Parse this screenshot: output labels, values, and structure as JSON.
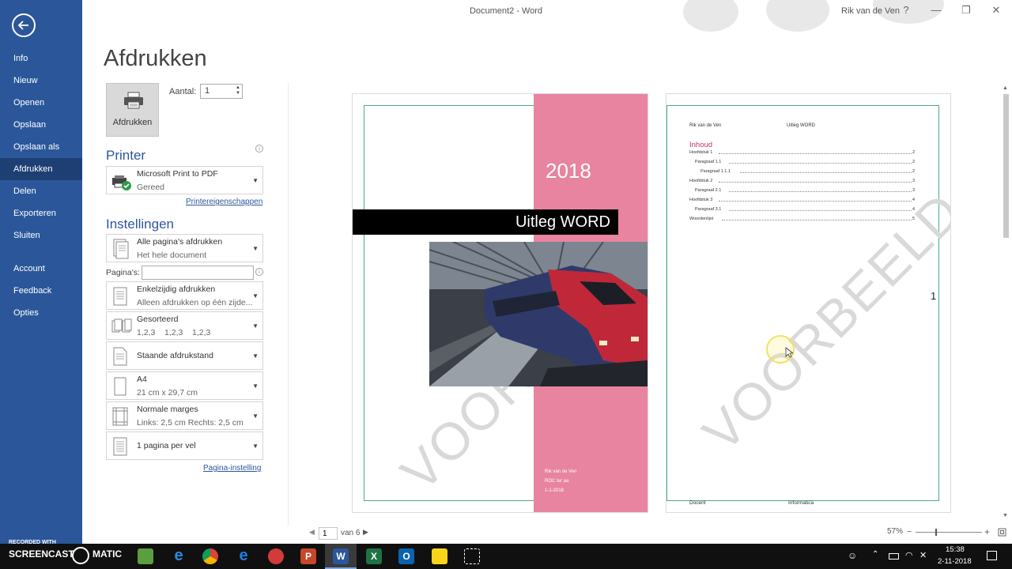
{
  "window": {
    "title": "Document2  -  Word",
    "user": "Rik van de Ven",
    "help": "?",
    "minimize": "—",
    "restore": "❐",
    "close": "✕"
  },
  "nav": {
    "items": [
      {
        "label": "Info"
      },
      {
        "label": "Nieuw"
      },
      {
        "label": "Openen"
      },
      {
        "label": "Opslaan"
      },
      {
        "label": "Opslaan als"
      },
      {
        "label": "Afdrukken"
      },
      {
        "label": "Delen"
      },
      {
        "label": "Exporteren"
      },
      {
        "label": "Sluiten"
      },
      {
        "label": "Account"
      },
      {
        "label": "Feedback"
      },
      {
        "label": "Opties"
      }
    ],
    "active": "Afdrukken"
  },
  "print": {
    "heading": "Afdrukken",
    "button_label": "Afdrukken",
    "copies_label": "Aantal:",
    "copies_value": "1",
    "printer_section": "Printer",
    "printer_name": "Microsoft Print to PDF",
    "printer_status": "Gereed",
    "printer_properties_link": "Printereigenschappen",
    "settings_section": "Instellingen",
    "pages_label": "Pagina's:",
    "pages_value": "",
    "setting_pages": {
      "main": "Alle pagina's afdrukken",
      "sub": "Het hele document"
    },
    "setting_sides": {
      "main": "Enkelzijdig afdrukken",
      "sub": "Alleen afdrukken op één zijde..."
    },
    "setting_collate": {
      "main": "Gesorteerd",
      "sub": "1,2,3    1,2,3    1,2,3"
    },
    "setting_orientation": {
      "main": "Staande afdrukstand"
    },
    "setting_paper": {
      "main": "A4",
      "sub": "21 cm x 29,7 cm"
    },
    "setting_margins": {
      "main": "Normale marges",
      "sub": "Links: 2,5 cm  Rechts: 2,5 cm"
    },
    "setting_persheet": {
      "main": "1 pagina per vel"
    },
    "page_setup_link": "Pagina-instelling"
  },
  "preview": {
    "cover": {
      "year": "2018",
      "title": "Uitleg WORD",
      "watermark": "VOORBEELD",
      "meta": [
        "Rik van de Ven",
        "ROC ter aa",
        "1-1-2018"
      ]
    },
    "toc_page": {
      "header_left": "Rik van de Ven",
      "header_center": "Uitleg WORD",
      "toc_title": "Inhoud",
      "toc": [
        {
          "label": "Hoofdstuk 1",
          "page": "2"
        },
        {
          "label": "Paragraaf 1.1",
          "page": "2"
        },
        {
          "label": "Paragraaf 1.1.1",
          "page": "2"
        },
        {
          "label": "Hoofdstuk 2",
          "page": "3"
        },
        {
          "label": "Paragraaf 2.1",
          "page": "3"
        },
        {
          "label": "Hoofdstuk 3",
          "page": "4"
        },
        {
          "label": "Paragraaf 3.1",
          "page": "4"
        },
        {
          "label": "Woordenlijst",
          "page": "5"
        }
      ],
      "watermark": "VOORBEELD",
      "page_number": "1",
      "footer_left": "Docent",
      "footer_center": "Informatica"
    },
    "current_page": "1",
    "of_pages": "van 6",
    "zoom": "57%"
  },
  "taskbar": {
    "time": "15:38",
    "date": "2-11-2018",
    "recorded_with": "RECORDED WITH",
    "brand": "SCREENCAST",
    "brand_suffix": "MATIC"
  },
  "colors": {
    "accent": "#2b579a",
    "cover_pink": "#e8849f",
    "frame_green": "#4aa98a",
    "toc_title": "#c0306a"
  }
}
